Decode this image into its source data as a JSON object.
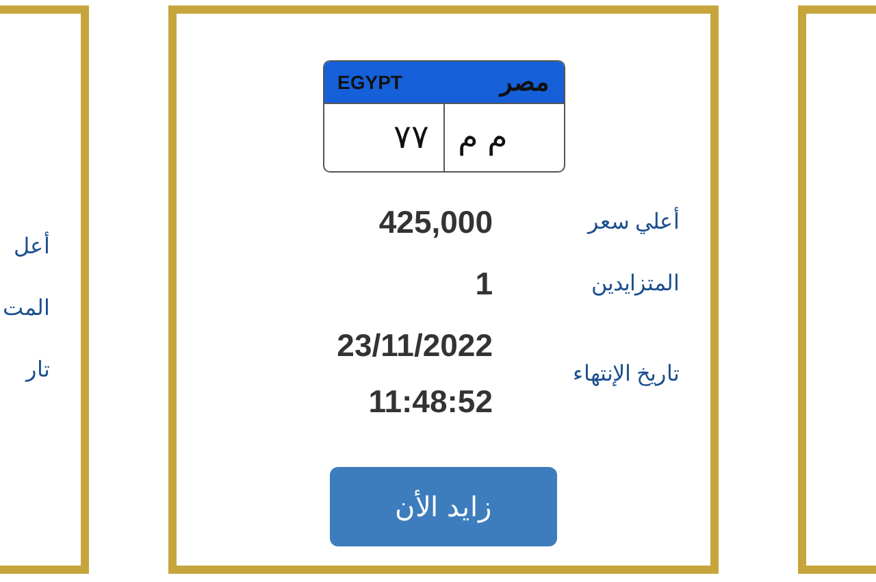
{
  "cards": [
    {
      "plate": {
        "country_en": "EGYPT",
        "country_ar": "مصر",
        "number": "٧٧",
        "letters": "م م"
      },
      "rows": [
        {
          "label": "أعلي سعر",
          "values": [
            "425,000"
          ]
        },
        {
          "label": "المتزايدين",
          "values": [
            "1"
          ]
        },
        {
          "label": "تاريخ الإنتهاء",
          "values": [
            "23/11/2022",
            "11:48:52"
          ]
        }
      ],
      "button": "زايد الأن"
    },
    {
      "rows": [
        {
          "label": "أعل"
        },
        {
          "label": "المت"
        },
        {
          "label": "تار"
        }
      ]
    }
  ]
}
